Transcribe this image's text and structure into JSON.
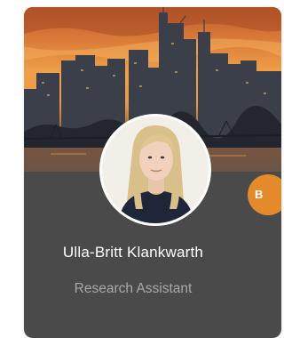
{
  "profile": {
    "name": "Ulla-Britt Klankwarth",
    "role": "Research Assistant",
    "badge_text": "B"
  },
  "colors": {
    "card_background": "#4a4a4a",
    "badge": "#e58a2a",
    "name_text": "#ffffff",
    "role_text": "#a9a9a9"
  },
  "images": {
    "banner": "city-skyline-at-sunset",
    "avatar": "profile-photo"
  }
}
